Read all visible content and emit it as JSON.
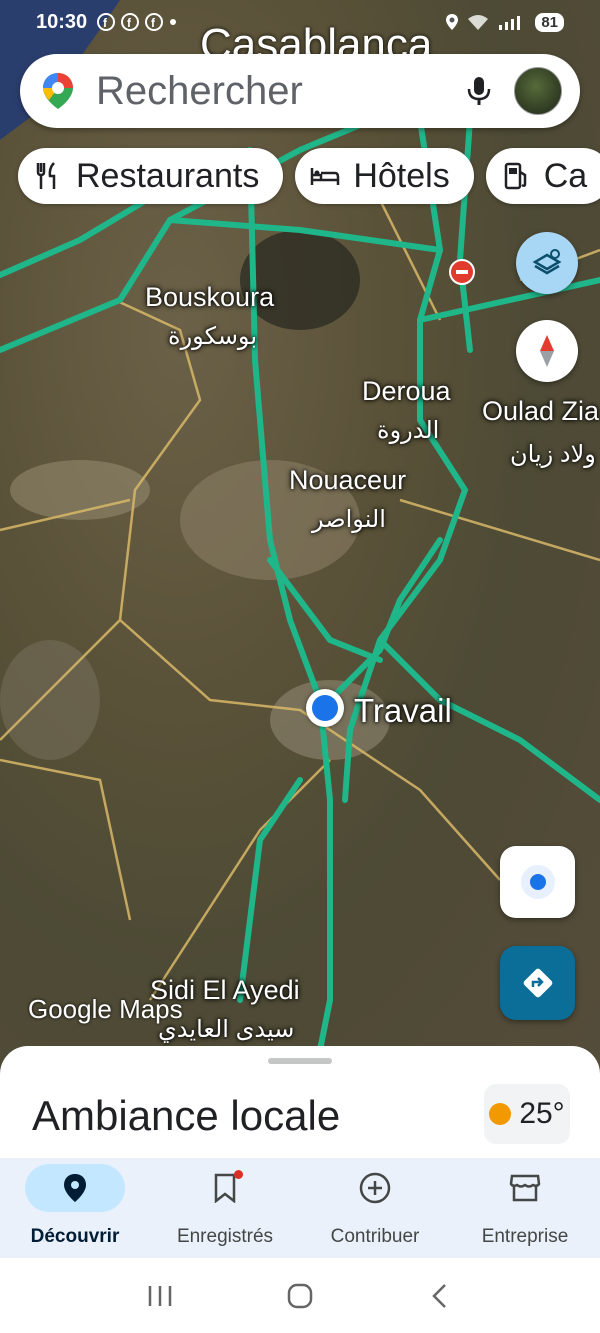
{
  "status_bar": {
    "time": "10:30",
    "notification_icons": [
      "facebook-icon",
      "facebook-icon",
      "facebook-icon"
    ],
    "battery": "81"
  },
  "search": {
    "placeholder": "Rechercher"
  },
  "chips": [
    {
      "label": "Restaurants",
      "icon": "restaurant-icon"
    },
    {
      "label": "Hôtels",
      "icon": "hotel-icon"
    },
    {
      "label": "Ca",
      "icon": "gas-station-icon"
    }
  ],
  "map": {
    "city_top": "Casablanca",
    "labels": {
      "bouskoura": "Bouskoura",
      "bouskoura_ar": "بوسكورة",
      "deroua": "Deroua",
      "deroua_ar": "الدروة",
      "oulad_ziane": "Oulad Zia",
      "oulad_ziane_ar": "ولاد زيان",
      "nouaceur": "Nouaceur",
      "nouaceur_ar": "النواصر",
      "sidi_el_ayedi": "Sidi El Ayedi",
      "sidi_el_ayedi_ar": "سيدى العايدي"
    },
    "current_place": "Travail",
    "attribution": "Google Maps"
  },
  "sheet": {
    "title": "Ambiance locale",
    "temperature": "25°"
  },
  "bottom_nav": [
    {
      "label": "Découvrir",
      "icon": "location-pin-icon",
      "active": true
    },
    {
      "label": "Enregistrés",
      "icon": "bookmark-icon",
      "active": false
    },
    {
      "label": "Contribuer",
      "icon": "add-circle-icon",
      "active": false
    },
    {
      "label": "Entreprise",
      "icon": "store-icon",
      "active": false
    }
  ]
}
